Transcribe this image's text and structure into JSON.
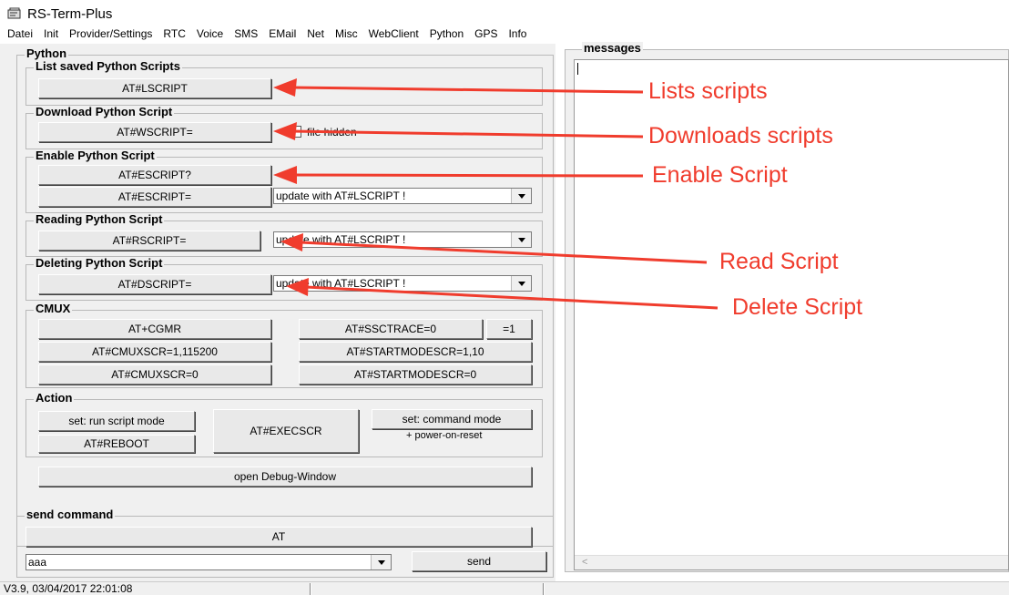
{
  "window": {
    "title": "RS-Term-Plus"
  },
  "menu": [
    "Datei",
    "Init",
    "Provider/Settings",
    "RTC",
    "Voice",
    "SMS",
    "EMail",
    "Net",
    "Misc",
    "WebClient",
    "Python",
    "GPS",
    "Info"
  ],
  "python": {
    "title": "Python",
    "list_group": {
      "title": "List saved Python Scripts",
      "button": "AT#LSCRIPT"
    },
    "download_group": {
      "title": "Download Python Script",
      "button": "AT#WSCRIPT=",
      "checkbox_label": "file hidden",
      "checkbox_checked": false
    },
    "enable_group": {
      "title": "Enable Python Script",
      "query_button": "AT#ESCRIPT?",
      "set_button": "AT#ESCRIPT=",
      "combo_value": "update with  AT#LSCRIPT !"
    },
    "read_group": {
      "title": "Reading Python Script",
      "button": "AT#RSCRIPT=",
      "combo_value": "update with  AT#LSCRIPT !"
    },
    "delete_group": {
      "title": "Deleting Python Script",
      "button": "AT#DSCRIPT=",
      "combo_value": "update with  AT#LSCRIPT !"
    },
    "cmux_group": {
      "title": "CMUX",
      "buttons": [
        "AT+CGMR",
        "AT#CMUXSCR=1,115200",
        "AT#CMUXSCR=0",
        "AT#SSCTRACE=0",
        "=1",
        "AT#STARTMODESCR=1,10",
        "AT#STARTMODESCR=0"
      ]
    },
    "action_group": {
      "title": "Action",
      "run_mode_button": "set: run script mode",
      "reboot_button": "AT#REBOOT",
      "exec_button": "AT#EXECSCR",
      "command_mode_button": "set: command mode",
      "power_note": "+ power-on-reset"
    },
    "debug_button": "open Debug-Window"
  },
  "send_command": {
    "title": "send command",
    "at_button": "AT",
    "input_value": "aaa",
    "send_button": "send"
  },
  "messages": {
    "title": "messages",
    "content": ""
  },
  "status": {
    "version": "V3.9, 03/04/2017 22:01:08"
  },
  "annotations": [
    "Lists scripts",
    "Downloads scripts",
    "Enable Script",
    "Read Script",
    "Delete Script"
  ],
  "colors": {
    "annotation": "#f03c2d",
    "panel_bg": "#f0f0f0"
  }
}
